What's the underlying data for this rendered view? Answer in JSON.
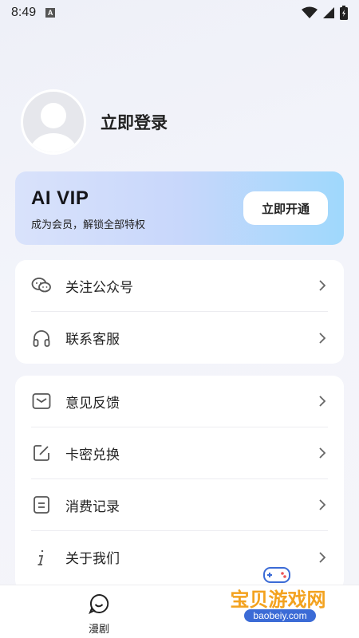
{
  "status_bar": {
    "time": "8:49",
    "notification_letter": "A"
  },
  "profile": {
    "login_label": "立即登录"
  },
  "vip": {
    "title": "AI VIP",
    "subtitle": "成为会员，解锁全部特权",
    "button_label": "立即开通"
  },
  "menu_group_1": [
    {
      "label": "关注公众号",
      "icon": "wechat-icon"
    },
    {
      "label": "联系客服",
      "icon": "headset-icon"
    }
  ],
  "menu_group_2": [
    {
      "label": "意见反馈",
      "icon": "mail-icon"
    },
    {
      "label": "卡密兑换",
      "icon": "edit-icon"
    },
    {
      "label": "消费记录",
      "icon": "document-icon"
    },
    {
      "label": "关于我们",
      "icon": "info-icon"
    }
  ],
  "bottom_nav": {
    "items": [
      {
        "label": "漫剧",
        "icon": "smile-chat-icon"
      }
    ]
  },
  "watermark": {
    "text": "宝贝游戏网",
    "url": "baobeiy.com"
  },
  "colors": {
    "vip_gradient_start": "#d9e2fb",
    "vip_gradient_end": "#9fd8fc",
    "watermark_orange": "#f3a21f",
    "watermark_blue": "#3b6bd6"
  }
}
